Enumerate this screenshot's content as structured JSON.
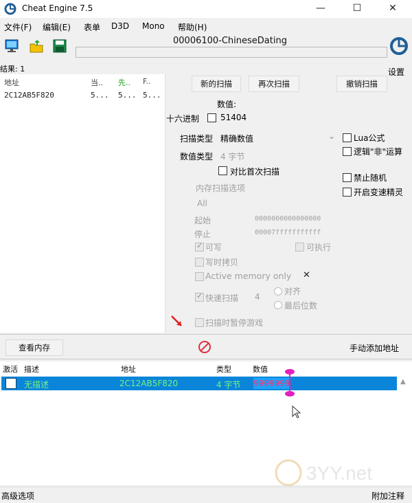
{
  "window": {
    "title": "Cheat Engine 7.5",
    "minimize": "—",
    "maximize": "☐",
    "close": "✕"
  },
  "menu": [
    "文件(F)",
    "编辑(E)",
    "表单",
    "D3D",
    "Mono",
    "帮助(H)"
  ],
  "process": {
    "title": "00006100-ChineseDating"
  },
  "settings_label": "设置",
  "results": {
    "label": "结果: 1",
    "columns": [
      "地址",
      "当..",
      "先..",
      "F.."
    ],
    "rows": [
      [
        "2C12AB5F820",
        "5...",
        "5...",
        "5..."
      ]
    ]
  },
  "scan": {
    "new_scan": "新的扫描",
    "next_scan": "再次扫描",
    "undo_scan": "撤销扫描",
    "value_label": "数值:",
    "hex_label": "十六进制",
    "value": "51404",
    "scan_type_label": "扫描类型",
    "scan_type_value": "精确数值",
    "value_type_label": "数值类型",
    "value_type_value": "4 字节",
    "compare_first": "对比首次扫描",
    "mem_options_label": "内存扫描选项",
    "region": "All",
    "start_label": "起始",
    "start_value": "0000000000000000",
    "stop_label": "停止",
    "stop_value": "00007fffffffffff",
    "writable": "可写",
    "executable": "可执行",
    "copy_on_write": "写时拷贝",
    "active_memory": "Active memory only",
    "fast_scan": "快速扫描",
    "fast_scan_value": "4",
    "align": "对齐",
    "last_digits": "最后位数",
    "pause_game": "扫描时暂停游戏",
    "lua_formula": "Lua公式",
    "not_logic": "逻辑\"非\"运算",
    "no_random": "禁止随机",
    "speedhack": "开启变速精灵"
  },
  "mid": {
    "view_memory": "查看内存",
    "add_address": "手动添加地址"
  },
  "addr_table": {
    "columns": [
      "激活",
      "描述",
      "地址",
      "类型",
      "数值"
    ],
    "rows": [
      {
        "desc": "无描述",
        "address": "2C12AB5F820",
        "type": "4 字节",
        "value": "9999999"
      }
    ]
  },
  "status": {
    "advanced": "高级选项",
    "add_comment": "附加注释"
  },
  "watermark": {
    "text": "3YY.net"
  },
  "colors": {
    "selected_row": "#0a85d9",
    "row_text": "#78f27a",
    "value_text": "#ff2e6a"
  }
}
